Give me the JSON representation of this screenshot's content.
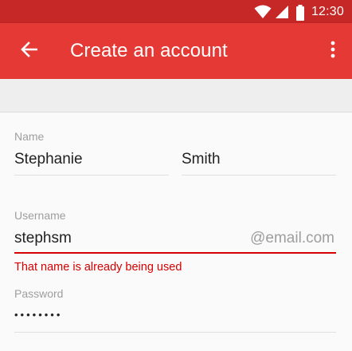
{
  "status_bar": {
    "time": "12:30",
    "icons": [
      "wifi-icon",
      "signal-icon",
      "battery-icon"
    ]
  },
  "app_bar": {
    "title": "Create an account",
    "back_icon": "arrow-back-icon",
    "menu_icon": "more-vert-icon"
  },
  "form": {
    "name": {
      "label": "Name",
      "first": "Stephanie",
      "last": "Smith"
    },
    "username": {
      "label": "Username",
      "value": "stephsm",
      "suffix": "@email.com",
      "error": "That name is already being used"
    },
    "password": {
      "label": "Password",
      "masked": "••••••••"
    }
  },
  "colors": {
    "status_bar": "#c62828",
    "app_bar": "#e53935",
    "error": "#d50000",
    "label": "#9e9e9e",
    "text": "#212121"
  }
}
